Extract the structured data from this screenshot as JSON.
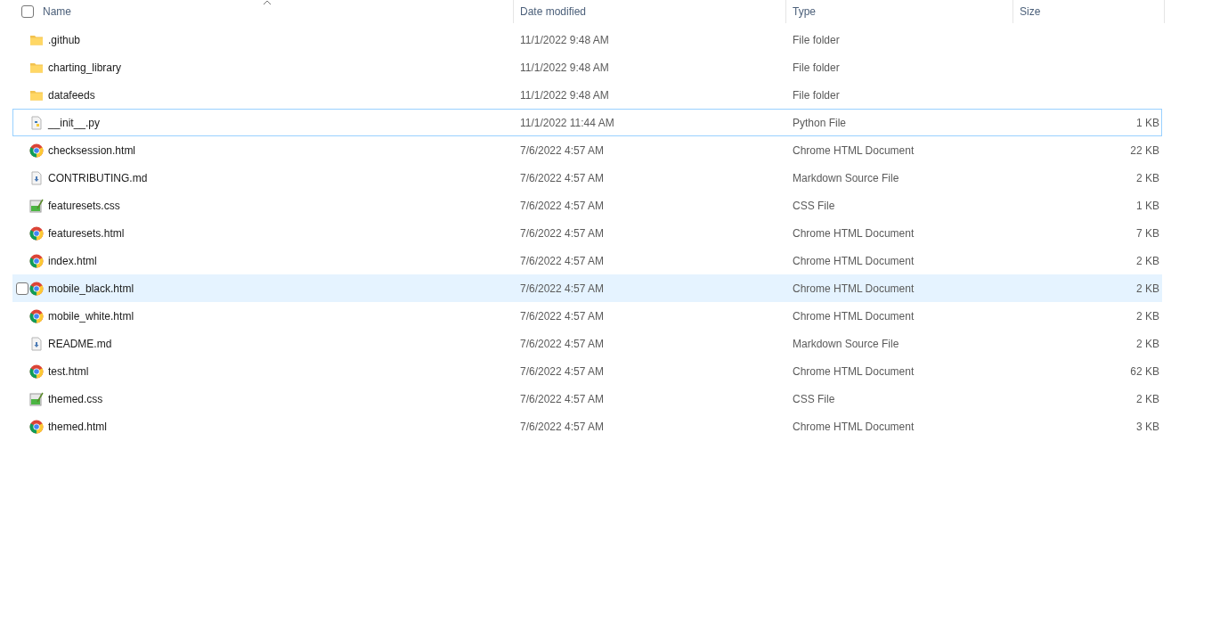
{
  "columns": [
    {
      "label": "Name",
      "sorted": true
    },
    {
      "label": "Date modified",
      "sorted": false
    },
    {
      "label": "Type",
      "sorted": false
    },
    {
      "label": "Size",
      "sorted": false
    }
  ],
  "header_checkbox": {
    "checked": false
  },
  "files": [
    {
      "name": ".github",
      "date": "11/1/2022 9:48 AM",
      "type": "File folder",
      "kind": "folder",
      "focused": false,
      "hovered": false
    },
    {
      "name": "charting_library",
      "date": "11/1/2022 9:48 AM",
      "type": "File folder",
      "kind": "folder",
      "focused": false,
      "hovered": false
    },
    {
      "name": "datafeeds",
      "date": "11/1/2022 9:48 AM",
      "type": "File folder",
      "kind": "folder",
      "focused": false,
      "hovered": false
    },
    {
      "name": "__init__.py",
      "date": "11/1/2022 11:44 AM",
      "type": "Python File",
      "size": "1 KB",
      "kind": "python",
      "focused": true,
      "hovered": false
    },
    {
      "name": "checksession.html",
      "date": "7/6/2022 4:57 AM",
      "type": "Chrome HTML Document",
      "size": "22 KB",
      "kind": "chrome",
      "focused": false,
      "hovered": false
    },
    {
      "name": "CONTRIBUTING.md",
      "date": "7/6/2022 4:57 AM",
      "type": "Markdown Source File",
      "size": "2 KB",
      "kind": "markdown",
      "focused": false,
      "hovered": false
    },
    {
      "name": "featuresets.css",
      "date": "7/6/2022 4:57 AM",
      "type": "CSS File",
      "size": "1 KB",
      "kind": "css",
      "focused": false,
      "hovered": false
    },
    {
      "name": "featuresets.html",
      "date": "7/6/2022 4:57 AM",
      "type": "Chrome HTML Document",
      "size": "7 KB",
      "kind": "chrome",
      "focused": false,
      "hovered": false
    },
    {
      "name": "index.html",
      "date": "7/6/2022 4:57 AM",
      "type": "Chrome HTML Document",
      "size": "2 KB",
      "kind": "chrome",
      "focused": false,
      "hovered": false
    },
    {
      "name": "mobile_black.html",
      "date": "7/6/2022 4:57 AM",
      "type": "Chrome HTML Document",
      "size": "2 KB",
      "kind": "chrome",
      "focused": false,
      "hovered": true
    },
    {
      "name": "mobile_white.html",
      "date": "7/6/2022 4:57 AM",
      "type": "Chrome HTML Document",
      "size": "2 KB",
      "kind": "chrome",
      "focused": false,
      "hovered": false
    },
    {
      "name": "README.md",
      "date": "7/6/2022 4:57 AM",
      "type": "Markdown Source File",
      "size": "2 KB",
      "kind": "markdown",
      "focused": false,
      "hovered": false
    },
    {
      "name": "test.html",
      "date": "7/6/2022 4:57 AM",
      "type": "Chrome HTML Document",
      "size": "62 KB",
      "kind": "chrome",
      "focused": false,
      "hovered": false
    },
    {
      "name": "themed.css",
      "date": "7/6/2022 4:57 AM",
      "type": "CSS File",
      "size": "2 KB",
      "kind": "css",
      "focused": false,
      "hovered": false
    },
    {
      "name": "themed.html",
      "date": "7/6/2022 4:57 AM",
      "type": "Chrome HTML Document",
      "size": "3 KB",
      "kind": "chrome",
      "focused": false,
      "hovered": false
    }
  ]
}
